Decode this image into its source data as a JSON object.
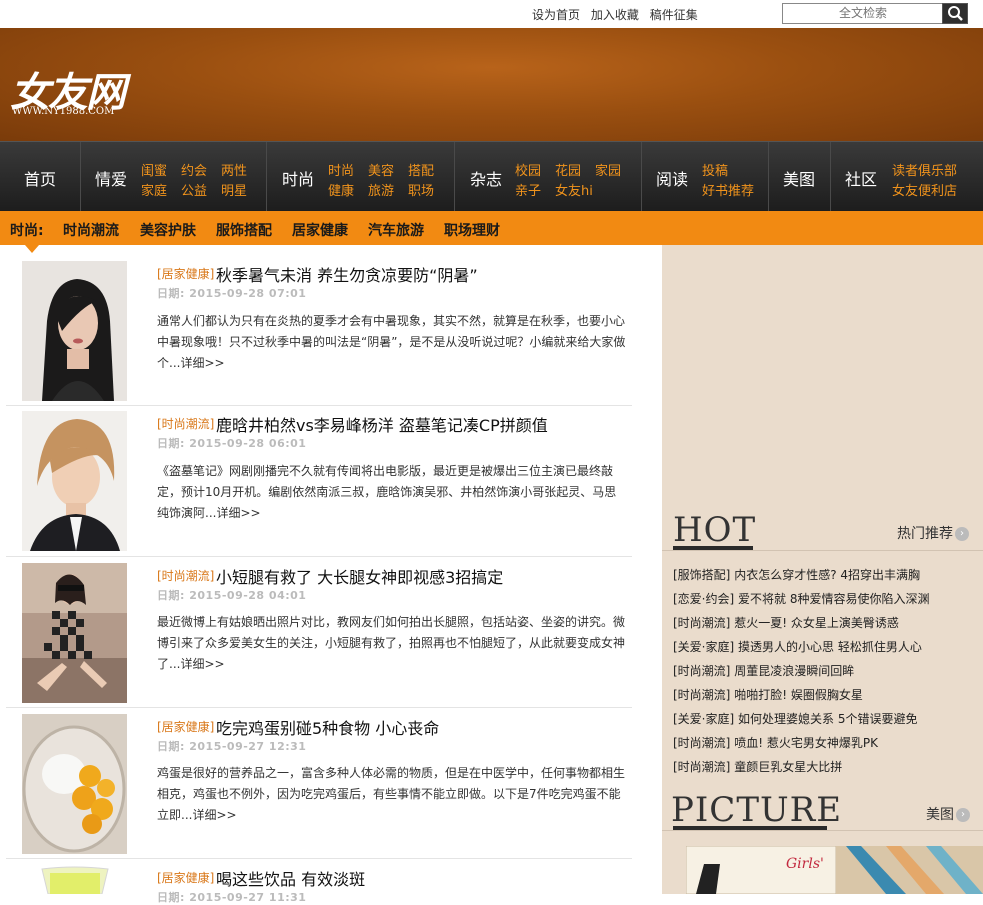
{
  "top": {
    "links": [
      "设为首页",
      "加入收藏",
      "稿件征集"
    ],
    "search_placeholder": "全文检索"
  },
  "logo": {
    "text": "女友网",
    "url": "WWW.NY1988.COM"
  },
  "nav": [
    {
      "main": "首页",
      "subs": []
    },
    {
      "main": "情爱",
      "subs": [
        "闺蜜",
        "约会",
        "两性",
        "家庭",
        "公益",
        "明星"
      ]
    },
    {
      "main": "时尚",
      "subs": [
        "时尚",
        "美容",
        "搭配",
        "健康",
        "旅游",
        "职场"
      ]
    },
    {
      "main": "杂志",
      "subs": [
        "校园",
        "花园",
        "家园",
        "亲子",
        "女友hi"
      ]
    },
    {
      "main": "阅读",
      "subs": [
        "投稿",
        "好书推荐"
      ]
    },
    {
      "main": "美图",
      "subs": []
    },
    {
      "main": "社区",
      "subs": [
        "读者俱乐部",
        "女友便利店"
      ]
    }
  ],
  "subnav": {
    "label": "时尚:",
    "items": [
      "时尚潮流",
      "美容护肤",
      "服饰搭配",
      "居家健康",
      "汽车旅游",
      "职场理财"
    ]
  },
  "articles": [
    {
      "category": "[居家健康]",
      "title": "秋季暑气未消 养生勿贪凉要防“阴暑”",
      "date": "日期: 2015-09-28 07:01",
      "summary": "通常人们都认为只有在炎热的夏季才会有中暑现象，其实不然，就算是在秋季，也要小心中暑现象哦！只不过秋季中暑的叫法是“阴暑”，是不是从没听说过呢？小编就来给大家做个...",
      "more": "详细>>"
    },
    {
      "category": "[时尚潮流]",
      "title": "鹿晗井柏然vs李易峰杨洋 盗墓笔记凑CP拼颜值",
      "date": "日期: 2015-09-28 06:01",
      "summary": "《盗墓笔记》网剧刚播完不久就有传闻将出电影版，最近更是被爆出三位主演已最终敲定，预计10月开机。编剧依然南派三叔，鹿晗饰演吴邪、井柏然饰演小哥张起灵、马思纯饰演阿...",
      "more": "详细>>"
    },
    {
      "category": "[时尚潮流]",
      "title": "小短腿有救了 大长腿女神即视感3招搞定",
      "date": "日期: 2015-09-28 04:01",
      "summary": "最近微博上有姑娘晒出照片对比，教网友们如何拍出长腿照，包括站姿、坐姿的讲究。微博引来了众多爱美女生的关注，小短腿有救了，拍照再也不怕腿短了，从此就要变成女神了...",
      "more": "详细>>"
    },
    {
      "category": "[居家健康]",
      "title": "吃完鸡蛋别碰5种食物 小心丧命",
      "date": "日期: 2015-09-27 12:31",
      "summary": "鸡蛋是很好的营养品之一，富含多种人体必需的物质，但是在中医学中，任何事物都相生相克，鸡蛋也不例外，因为吃完鸡蛋后，有些事情不能立即做。以下是7件吃完鸡蛋不能立即...",
      "more": "详细>>"
    },
    {
      "category": "[居家健康]",
      "title": "喝这些饮品 有效淡斑",
      "date": "日期: 2015-09-27 11:31",
      "summary": "",
      "more": ""
    }
  ],
  "hot": {
    "title": "HOT",
    "more": "热门推荐",
    "items": [
      {
        "cat": "[服饰搭配]",
        "text": "内衣怎么穿才性感? 4招穿出丰满胸"
      },
      {
        "cat": "[恋爱·约会]",
        "text": "爱不将就 8种爱情容易使你陷入深渊"
      },
      {
        "cat": "[时尚潮流]",
        "text": "惹火一夏! 众女星上演美臀诱惑"
      },
      {
        "cat": "[关爱·家庭]",
        "text": "摸透男人的小心思 轻松抓住男人心"
      },
      {
        "cat": "[时尚潮流]",
        "text": "周董昆凌浪漫瞬间回眸"
      },
      {
        "cat": "[时尚潮流]",
        "text": "啪啪打脸! 娱圈假胸女星"
      },
      {
        "cat": "[关爱·家庭]",
        "text": "如何处理婆媳关系 5个错误要避免"
      },
      {
        "cat": "[时尚潮流]",
        "text": "喷血! 惹火宅男女神爆乳PK"
      },
      {
        "cat": "[时尚潮流]",
        "text": "童颜巨乳女星大比拼"
      }
    ]
  },
  "picture": {
    "title": "PICTURE",
    "more": "美图"
  },
  "colors": {
    "accent": "#f28a12",
    "nav_bg": "#262626",
    "sidebar_bg": "#eadccc"
  }
}
